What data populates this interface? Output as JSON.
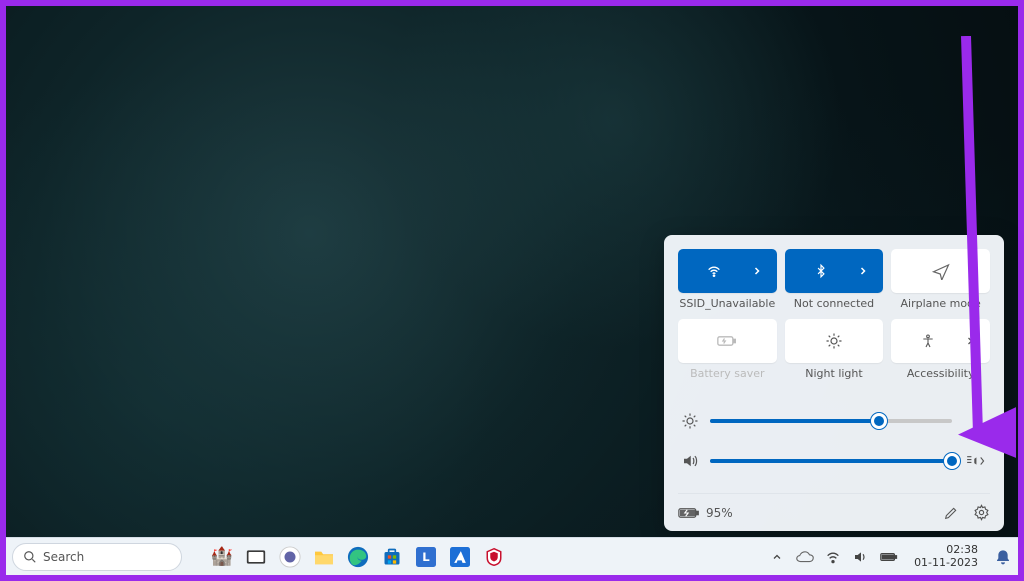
{
  "taskbar": {
    "search_placeholder": "Search",
    "clock_time": "02:38",
    "clock_date": "01-11-2023"
  },
  "panel": {
    "tiles": {
      "wifi": {
        "label": "SSID_Unavailable",
        "active": true
      },
      "bluetooth": {
        "label": "Not connected",
        "active": true
      },
      "airplane": {
        "label": "Airplane mode",
        "active": false
      },
      "battery_saver": {
        "label": "Battery saver",
        "disabled": true
      },
      "night_light": {
        "label": "Night light",
        "active": false
      },
      "accessibility": {
        "label": "Accessibility",
        "active": false
      }
    },
    "brightness_percent": 70,
    "volume_percent": 100,
    "battery_text": "95%"
  },
  "colors": {
    "accent": "#0067c0",
    "annotation": "#9a2aeb"
  }
}
